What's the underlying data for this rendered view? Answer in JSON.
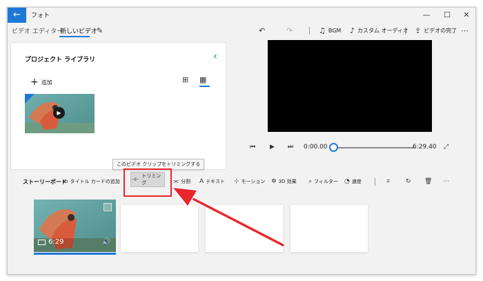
{
  "titlebar": {
    "back_icon": "back-arrow-icon",
    "app_title": "フォト",
    "minimize_icon": "minimize-icon",
    "maximize_icon": "maximize-icon",
    "close_icon": "close-icon"
  },
  "commandbar": {
    "breadcrumb_parent": "ビデオ エディター",
    "breadcrumb_current": "新しいビデオ",
    "edit_icon": "pencil-icon",
    "undo_icon": "undo-icon",
    "redo_icon": "redo-icon",
    "bgm_label": "BGM",
    "custom_audio_label": "カスタム オーディオ",
    "finish_video_label": "ビデオの完了",
    "more_icon": "more-icon"
  },
  "library": {
    "title": "プロジェクト ライブラリ",
    "add_label": "追加",
    "collapse_icon": "chevron-left-icon",
    "grid_large_icon": "grid-large-icon",
    "grid_small_icon": "grid-small-icon"
  },
  "player": {
    "current_time": "0:00.00",
    "total_time": "6:29.40",
    "progress_fraction": 0.0
  },
  "storyboard": {
    "label": "ストーリーボード",
    "title_card_label": "タイトル カードの追加",
    "trim_label": "トリミング",
    "trim_tooltip": "このビデオ クリップをトリミングする",
    "split_label": "分割",
    "text_label": "テキスト",
    "motion_label": "モーション",
    "effects_3d_label": "3D 効果",
    "filter_label": "フィルター",
    "speed_label": "速度",
    "clip_duration": "6:29"
  },
  "colors": {
    "accent": "#1e78d7",
    "highlight": "#e8262b",
    "preview_bg": "#000000"
  }
}
